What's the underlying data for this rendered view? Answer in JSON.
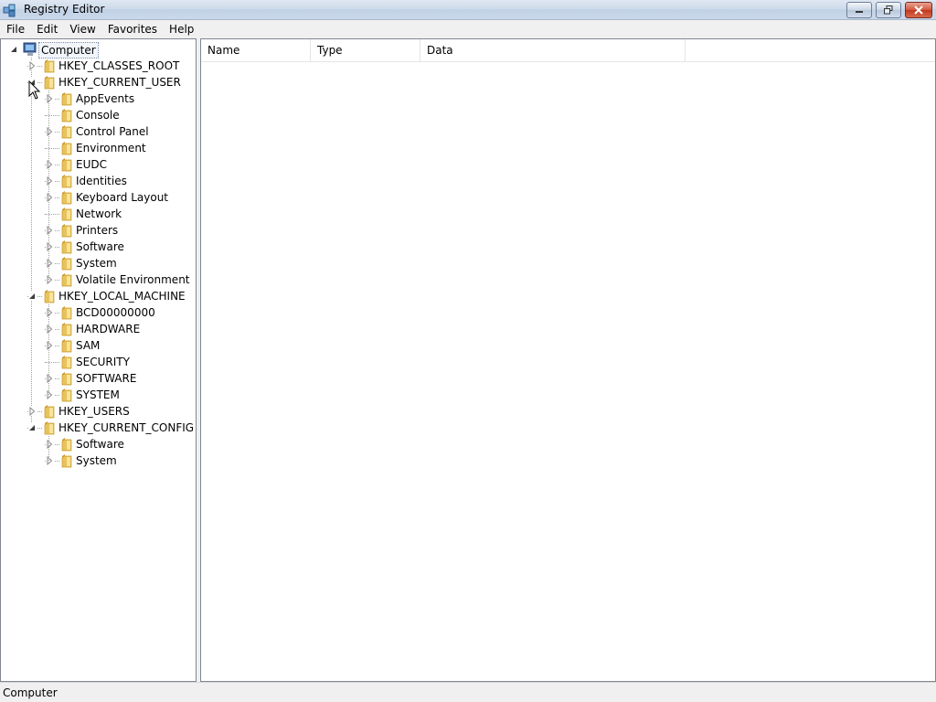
{
  "window": {
    "title": "Registry Editor"
  },
  "menu": [
    "File",
    "Edit",
    "View",
    "Favorites",
    "Help"
  ],
  "list": {
    "columns": [
      "Name",
      "Type",
      "Data"
    ]
  },
  "tree": {
    "root": {
      "label": "Computer",
      "icon": "computer-icon",
      "expanded": true,
      "selected": true
    },
    "hives": [
      {
        "label": "HKEY_CLASSES_ROOT",
        "expanded": false,
        "children": []
      },
      {
        "label": "HKEY_CURRENT_USER",
        "expanded": true,
        "children": [
          {
            "label": "AppEvents",
            "has_children": true
          },
          {
            "label": "Console",
            "has_children": false
          },
          {
            "label": "Control Panel",
            "has_children": true
          },
          {
            "label": "Environment",
            "has_children": false
          },
          {
            "label": "EUDC",
            "has_children": true
          },
          {
            "label": "Identities",
            "has_children": true
          },
          {
            "label": "Keyboard Layout",
            "has_children": true
          },
          {
            "label": "Network",
            "has_children": false
          },
          {
            "label": "Printers",
            "has_children": true
          },
          {
            "label": "Software",
            "has_children": true
          },
          {
            "label": "System",
            "has_children": true
          },
          {
            "label": "Volatile Environment",
            "has_children": true
          }
        ]
      },
      {
        "label": "HKEY_LOCAL_MACHINE",
        "expanded": true,
        "children": [
          {
            "label": "BCD00000000",
            "has_children": true
          },
          {
            "label": "HARDWARE",
            "has_children": true
          },
          {
            "label": "SAM",
            "has_children": true
          },
          {
            "label": "SECURITY",
            "has_children": false
          },
          {
            "label": "SOFTWARE",
            "has_children": true
          },
          {
            "label": "SYSTEM",
            "has_children": true
          }
        ]
      },
      {
        "label": "HKEY_USERS",
        "expanded": false,
        "children": []
      },
      {
        "label": "HKEY_CURRENT_CONFIG",
        "expanded": true,
        "children": [
          {
            "label": "Software",
            "has_children": true
          },
          {
            "label": "System",
            "has_children": true
          }
        ]
      }
    ]
  },
  "status": {
    "text": "Computer"
  },
  "colors": {
    "folder": "#e8c25a",
    "folder_dark": "#c99a2e",
    "selection_border": "#7a8ea8"
  }
}
